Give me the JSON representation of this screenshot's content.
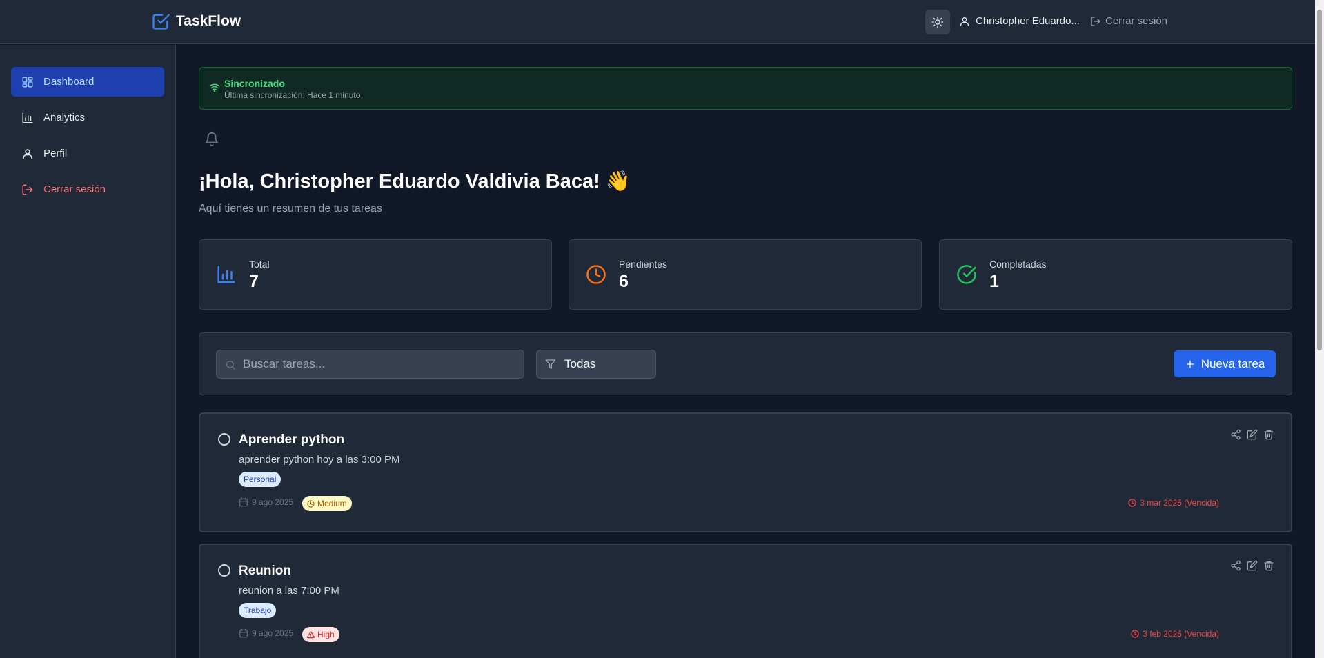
{
  "header": {
    "app_name": "TaskFlow",
    "user_name": "Christopher Eduardo...",
    "logout_label": "Cerrar sesión"
  },
  "sidebar": {
    "items": [
      {
        "label": "Dashboard",
        "icon": "dashboard-icon",
        "active": true
      },
      {
        "label": "Analytics",
        "icon": "chart-icon"
      },
      {
        "label": "Perfil",
        "icon": "user-icon"
      },
      {
        "label": "Cerrar sesión",
        "icon": "logout-icon"
      }
    ]
  },
  "sync": {
    "title": "Sincronizado",
    "subtitle": "Última sincronización: Hace 1 minuto"
  },
  "main": {
    "greeting": "¡Hola, Christopher Eduardo Valdivia Baca! 👋",
    "subtitle": "Aquí tienes un resumen de tus tareas"
  },
  "stats": [
    {
      "label": "Total",
      "value": "7",
      "icon": "bar-chart-icon",
      "color": "#3b82f6"
    },
    {
      "label": "Pendientes",
      "value": "6",
      "icon": "clock-icon",
      "color": "#f97316"
    },
    {
      "label": "Completadas",
      "value": "1",
      "icon": "check-circle-icon",
      "color": "#22c55e"
    }
  ],
  "toolbar": {
    "search_placeholder": "Buscar tareas...",
    "filter_value": "Todas",
    "new_task_label": "Nueva tarea"
  },
  "tasks": [
    {
      "title": "Aprender python",
      "description": "aprender python hoy a las 3:00 PM",
      "tag": "Personal",
      "created": "9 ago 2025",
      "priority": "Medium",
      "due": "3 mar 2025 (Vencida)"
    },
    {
      "title": "Reunion",
      "description": "reunion a las 7:00 PM",
      "tag": "Trabajo",
      "created": "9 ago 2025",
      "priority": "High",
      "due": "3 feb 2025 (Vencida)"
    }
  ],
  "colors": {
    "accent": "#2563eb",
    "success": "#4ade80",
    "danger": "#ef4444"
  }
}
